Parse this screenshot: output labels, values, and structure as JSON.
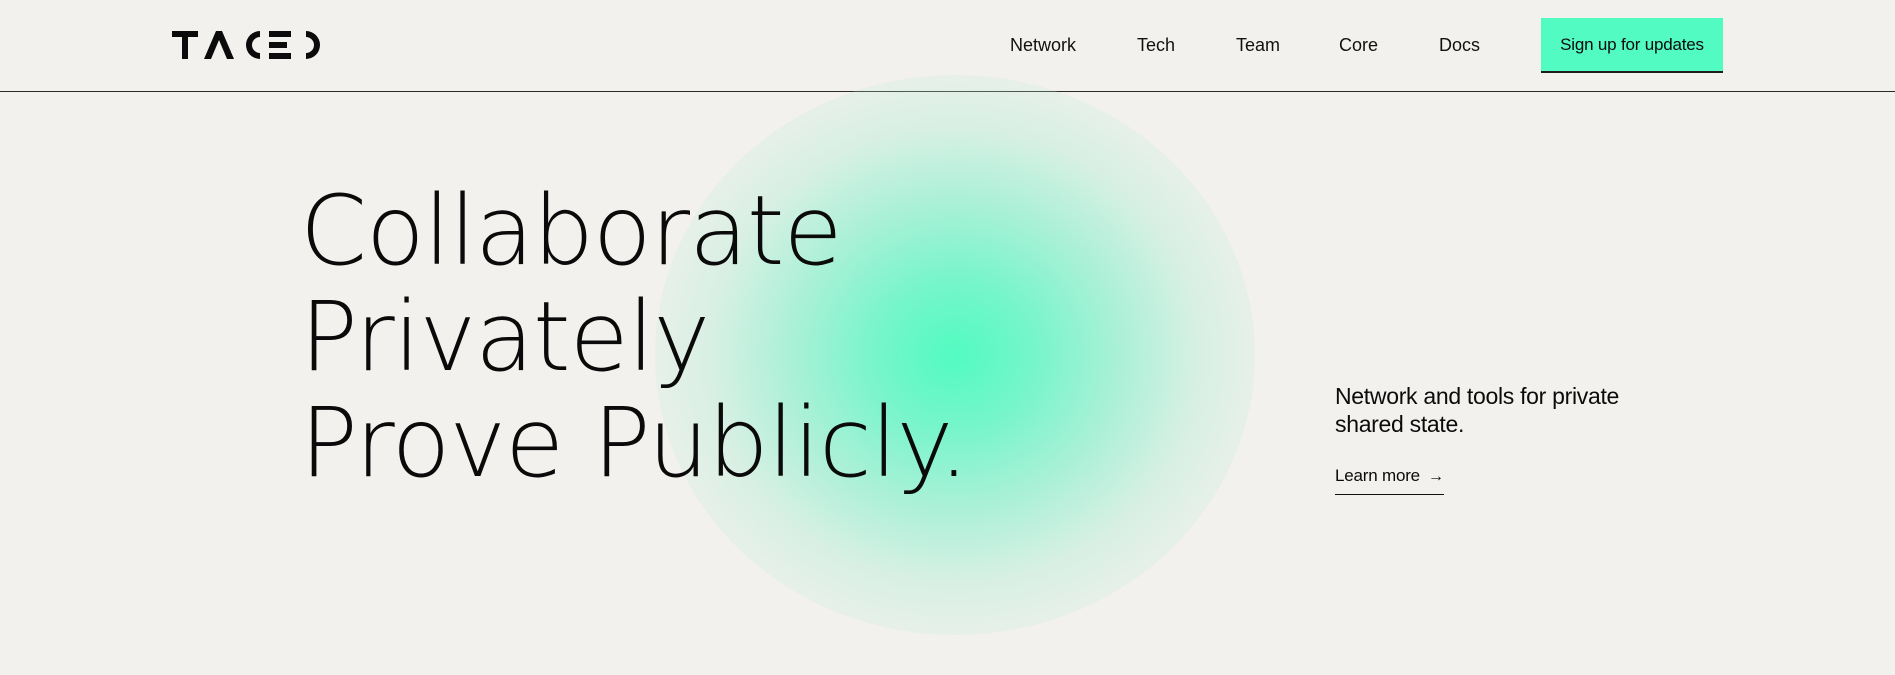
{
  "brand": {
    "logo_text": "TACEO"
  },
  "nav": {
    "items": [
      {
        "label": "Network"
      },
      {
        "label": "Tech"
      },
      {
        "label": "Team"
      },
      {
        "label": "Core"
      },
      {
        "label": "Docs"
      }
    ],
    "cta_label": "Sign up for updates"
  },
  "hero": {
    "lines": [
      "Collaborate",
      "Privately",
      "Prove Publicly."
    ],
    "tagline": "Network and tools for private shared state.",
    "learn_more_label": "Learn more",
    "learn_more_icon": "arrow-right-icon"
  },
  "colors": {
    "background": "#f2f1ed",
    "accent": "#52fbc1",
    "text": "#0b0b0b"
  }
}
